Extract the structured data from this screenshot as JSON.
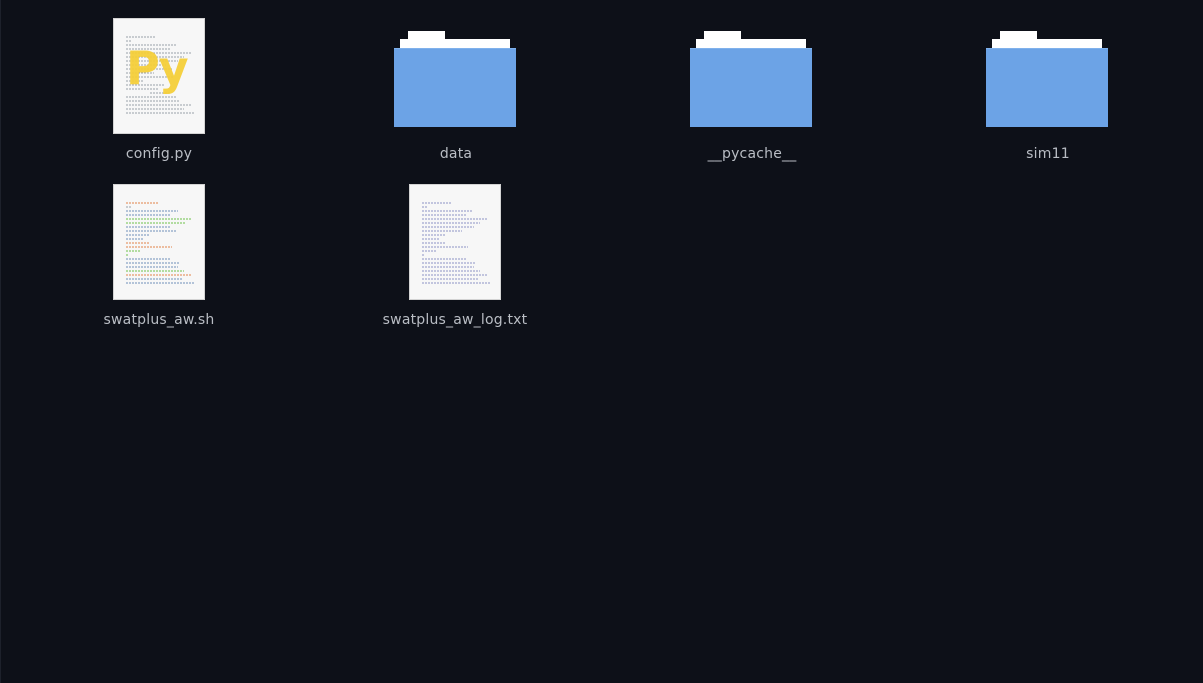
{
  "files": [
    {
      "name": "config.py",
      "kind": "python",
      "icon": "python-file-icon",
      "badge": "Py"
    },
    {
      "name": "data",
      "kind": "folder",
      "icon": "folder-icon"
    },
    {
      "name": "__pycache__",
      "kind": "folder",
      "icon": "folder-icon"
    },
    {
      "name": "sim11",
      "kind": "folder",
      "icon": "folder-icon"
    },
    {
      "name": "swatplus_aw.sh",
      "kind": "shell",
      "icon": "shell-script-icon"
    },
    {
      "name": "swatplus_aw_log.txt",
      "kind": "text",
      "icon": "text-file-icon"
    }
  ],
  "colors": {
    "background": "#0d1018",
    "folder_body": "#6ca3e6",
    "folder_paper": "#ffffff",
    "label": "#b9bdc4",
    "python_badge": "#f5cf3a"
  }
}
